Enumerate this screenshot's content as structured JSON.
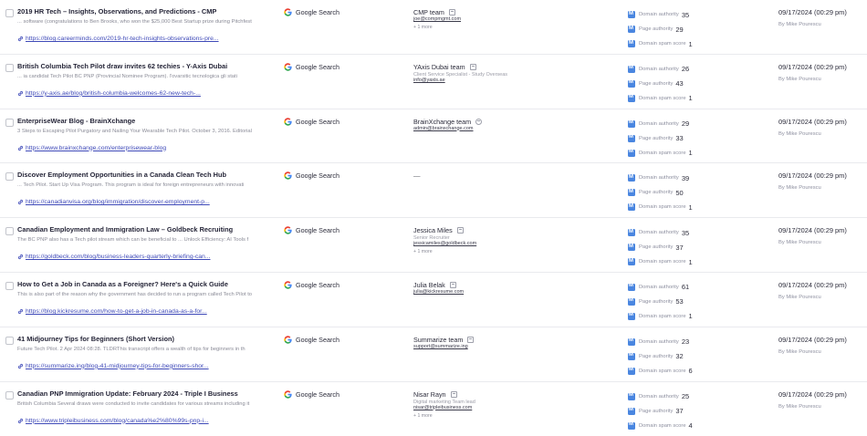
{
  "source_icon": "google-icon",
  "metric_icon": "moz-icon",
  "colors": {
    "link": "#3e49b8",
    "metric_icon": "#4a86e0",
    "muted": "#8e90a0"
  },
  "rows": [
    {
      "title": "2019 HR Tech – Insights, Observations, and Predictions - CMP",
      "snippet": "... software (congratulations to Ben Brooks, who won the $25,000 Best Startup prize during Pitchfest",
      "url": "https://blog.careerminds.com/2019-hr-tech-insights-observations-pre...",
      "source": "Google Search",
      "contact": {
        "name": "CMP team",
        "role": "",
        "email": "joe@compmgmt.com",
        "more": "+ 1 more",
        "dash": ""
      },
      "metrics": {
        "da_label": "Domain authority",
        "da": "35",
        "pa_label": "Page authority",
        "pa": "29",
        "ss_label": "Domain spam score",
        "ss": "1"
      },
      "date": "09/17/2024 (00:29 pm)",
      "by": "By Mike Pourescu"
    },
    {
      "title": "British Columbia Tech Pilot draw invites 62 techies - Y-Axis Dubai",
      "snippet": "... ia candidat Tech Pilot BC PNP (Provincial Nominee Program). l'ovarsitic tecnologica gli stati",
      "url": "https://y-axis.ae/blog/british-columbia-welcomes-62-new-tech-...",
      "source": "Google Search",
      "contact": {
        "name": "YAxis Dubai team",
        "role": "Client Service Specialist - Study Overseas",
        "email": "info@yaxis.ae",
        "more": "",
        "dash": ""
      },
      "metrics": {
        "da_label": "Domain authority",
        "da": "26",
        "pa_label": "Page authority",
        "pa": "43",
        "ss_label": "Domain spam score",
        "ss": "1"
      },
      "date": "09/17/2024 (00:29 pm)",
      "by": "By Mike Pourescu"
    },
    {
      "title": "EnterpriseWear Blog - BrainXchange",
      "snippet": "3 Steps to Escaping Pilot Purgatory and Nailing Your Wearable Tech Pilot. October 3, 2016. Editorial",
      "url": "https://www.brainxchange.com/enterprisewear-blog",
      "source": "Google Search",
      "contact": {
        "name": "BrainXchange team",
        "role": "",
        "email": "admin@brainxchange.com",
        "more": "",
        "dash": ""
      },
      "metrics": {
        "da_label": "Domain authority",
        "da": "29",
        "pa_label": "Page authority",
        "pa": "33",
        "ss_label": "Domain spam score",
        "ss": "1"
      },
      "date": "09/17/2024 (00:29 pm)",
      "by": "By Mike Pourescu"
    },
    {
      "title": "Discover Employment Opportunities in a Canada Clean Tech Hub",
      "snippet": "... Tech Pilot. Start Up Visa Program. This program is ideal for foreign entrepreneurs with innovati",
      "url": "https://canadianvisa.org/blog/immigration/discover-employment-p...",
      "source": "Google Search",
      "contact": {
        "name": "",
        "role": "",
        "email": "",
        "more": "",
        "dash": "—"
      },
      "metrics": {
        "da_label": "Domain authority",
        "da": "39",
        "pa_label": "Page authority",
        "pa": "50",
        "ss_label": "Domain spam score",
        "ss": "1"
      },
      "date": "09/17/2024 (00:29 pm)",
      "by": "By Mike Pourescu"
    },
    {
      "title": "Canadian Employment and Immigration Law – Goldbeck Recruiting",
      "snippet": "The BC PNP also has a Tech pilot stream which can be beneficial to ... Unlock Efficiency: AI Tools f",
      "url": "https://goldbeck.com/blog/business-leaders-quarterly-briefing-can...",
      "source": "Google Search",
      "contact": {
        "name": "Jessica Miles",
        "role": "Senior Recruiter",
        "email": "jessicamiles@goldbeck.com",
        "more": "+ 1 more",
        "dash": ""
      },
      "metrics": {
        "da_label": "Domain authority",
        "da": "35",
        "pa_label": "Page authority",
        "pa": "37",
        "ss_label": "Domain spam score",
        "ss": "1"
      },
      "date": "09/17/2024 (00:29 pm)",
      "by": "By Mike Pourescu"
    },
    {
      "title": "How to Get a Job in Canada as a Foreigner? Here's a Quick Guide",
      "snippet": "This is also part of the reason why the government has decided to run a program called Tech Pilot to",
      "url": "https://blog.kickresume.com/how-to-get-a-job-in-canada-as-a-for...",
      "source": "Google Search",
      "contact": {
        "name": "Julia Belak",
        "role": "",
        "email": "julia@kickresume.com",
        "more": "",
        "dash": ""
      },
      "metrics": {
        "da_label": "Domain authority",
        "da": "61",
        "pa_label": "Page authority",
        "pa": "53",
        "ss_label": "Domain spam score",
        "ss": "1"
      },
      "date": "09/17/2024 (00:29 pm)",
      "by": "By Mike Pourescu"
    },
    {
      "title": "41 Midjourney Tips for Beginners (Short Version)",
      "snippet": "Future Tech Pilot. 2 Apr 2024 08:28. TLDRThis transcript offers a wealth of tips for beginners in th",
      "url": "https://summarize.ing/blog-41-midjourney-tips-for-beginners-shor...",
      "source": "Google Search",
      "contact": {
        "name": "Summarize team",
        "role": "",
        "email": "support@summarize.ing",
        "more": "",
        "dash": ""
      },
      "metrics": {
        "da_label": "Domain authority",
        "da": "23",
        "pa_label": "Page authority",
        "pa": "32",
        "ss_label": "Domain spam score",
        "ss": "6"
      },
      "date": "09/17/2024 (00:29 pm)",
      "by": "By Mike Pourescu"
    },
    {
      "title": "Canadian PNP Immigration Update: February 2024 - Triple I Business",
      "snippet": "British Columbia Several draws were conducted to invite candidates for various streams including it",
      "url": "https://www.tripleibusiness.com/blog/canada%e2%80%99s-pnp-i...",
      "source": "Google Search",
      "contact": {
        "name": "Nisar Rayn",
        "role": "Digital marketing Team lead",
        "email": "nisar@tripleibusiness.com",
        "more": "+ 1 more",
        "dash": ""
      },
      "metrics": {
        "da_label": "Domain authority",
        "da": "25",
        "pa_label": "Page authority",
        "pa": "37",
        "ss_label": "Domain spam score",
        "ss": "4"
      },
      "date": "09/17/2024 (00:29 pm)",
      "by": "By Mike Pourescu"
    }
  ]
}
